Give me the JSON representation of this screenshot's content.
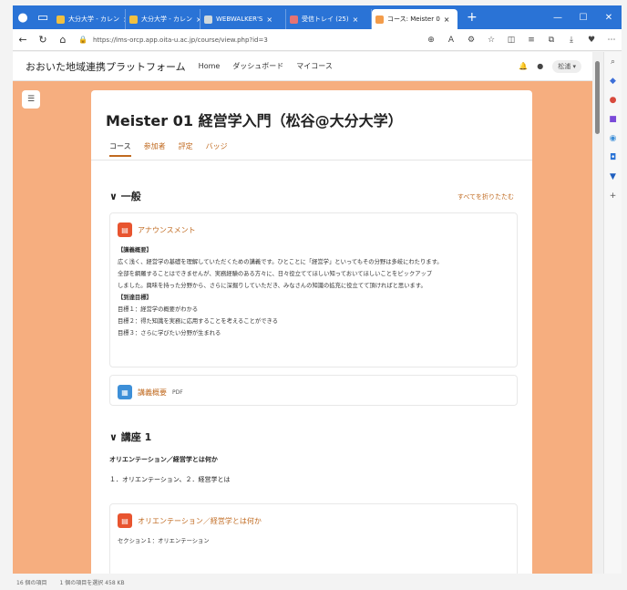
{
  "browser": {
    "tabs": [
      {
        "label": "大分大学 - カレン",
        "color": "#f0c040"
      },
      {
        "label": "大分大学 - カレン",
        "color": "#f0c040"
      },
      {
        "label": "WEBWALKER'S",
        "color": "#cfd8dc"
      },
      {
        "label": "受信トレイ (25)",
        "color": "#e57373"
      },
      {
        "label": "コース: Meister 0",
        "color": "#f39c4a"
      }
    ],
    "new_tab": "+",
    "url": "https://lms-orcp.app.oita-u.ac.jp/course/view.php?id=3"
  },
  "site": {
    "name": "おおいた地域連携プラットフォーム",
    "nav": [
      "Home",
      "ダッシュボード",
      "マイコース"
    ],
    "user": "松浦"
  },
  "course": {
    "title": "Meister 01 経営学入門（松谷@大分大学）",
    "tabs": [
      "コース",
      "参加者",
      "評定",
      "バッジ"
    ],
    "collapse_all": "すべてを折りたたむ",
    "section_general": "一般",
    "announcement": {
      "name": "アナウンスメント",
      "desc_heading1": "【講義概要】",
      "desc_lines1": [
        "広く浅く、経営学の基礎を理解していただくための講義です。ひとことに「経営学」といってもその分野は多岐にわたります。",
        "全部を網羅することはできませんが、実務経験のある方々に、日々役立ててほしい知っておいてほしいことをピックアップ",
        "しました。興味を持った分野から、さらに深掘りしていただき、みなさんの知識の拡充に役立てて頂ければと思います。"
      ],
      "desc_heading2": "【到達目標】",
      "desc_lines2": [
        "目標１：経営学の概要がわかる",
        "目標２：得た知識を実務に応用することを考えることができる",
        "目標３：さらに学びたい分野が生まれる"
      ]
    },
    "syllabus": {
      "name": "講義概要",
      "badge": "PDF"
    },
    "section1": {
      "title": "講座 1",
      "subtitle": "オリエンテーション／経営学とは何か",
      "summary": "１．オリエンテーション、２．経営学とは",
      "activity_name": "オリエンテーション／経営学とは何か",
      "activity_desc": "セクション１：オリエンテーション"
    }
  },
  "statusbar": {
    "left": "16 個の項目",
    "right": "1 個の項目を選択 458 KB"
  },
  "colors": {
    "accent": "#c06a20",
    "page_bg": "#f6ae7f",
    "forum_icon": "#e8542f",
    "file_icon": "#3d8fd8"
  }
}
